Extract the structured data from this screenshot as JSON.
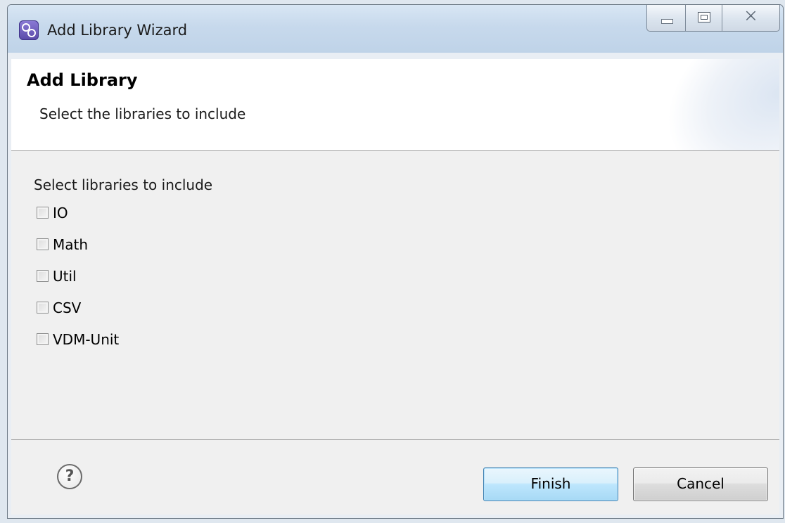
{
  "window": {
    "title": "Add Library Wizard",
    "controls": {
      "minimize_icon": "minimize-icon",
      "maximize_icon": "maximize-icon",
      "close_glyph": "⨉"
    }
  },
  "header": {
    "title": "Add Library",
    "description": "Select the libraries to include"
  },
  "content": {
    "group_label": "Select libraries to include",
    "libraries": [
      {
        "label": "IO",
        "checked": false
      },
      {
        "label": "Math",
        "checked": false
      },
      {
        "label": "Util",
        "checked": false
      },
      {
        "label": "CSV",
        "checked": false
      },
      {
        "label": "VDM-Unit",
        "checked": false
      }
    ]
  },
  "footer": {
    "help_glyph": "?",
    "finish_label": "Finish",
    "cancel_label": "Cancel"
  },
  "colors": {
    "accent_button_border": "#3c7fb1",
    "titlebar": "#c7d9ec",
    "content_bg": "#f0f0f0"
  }
}
